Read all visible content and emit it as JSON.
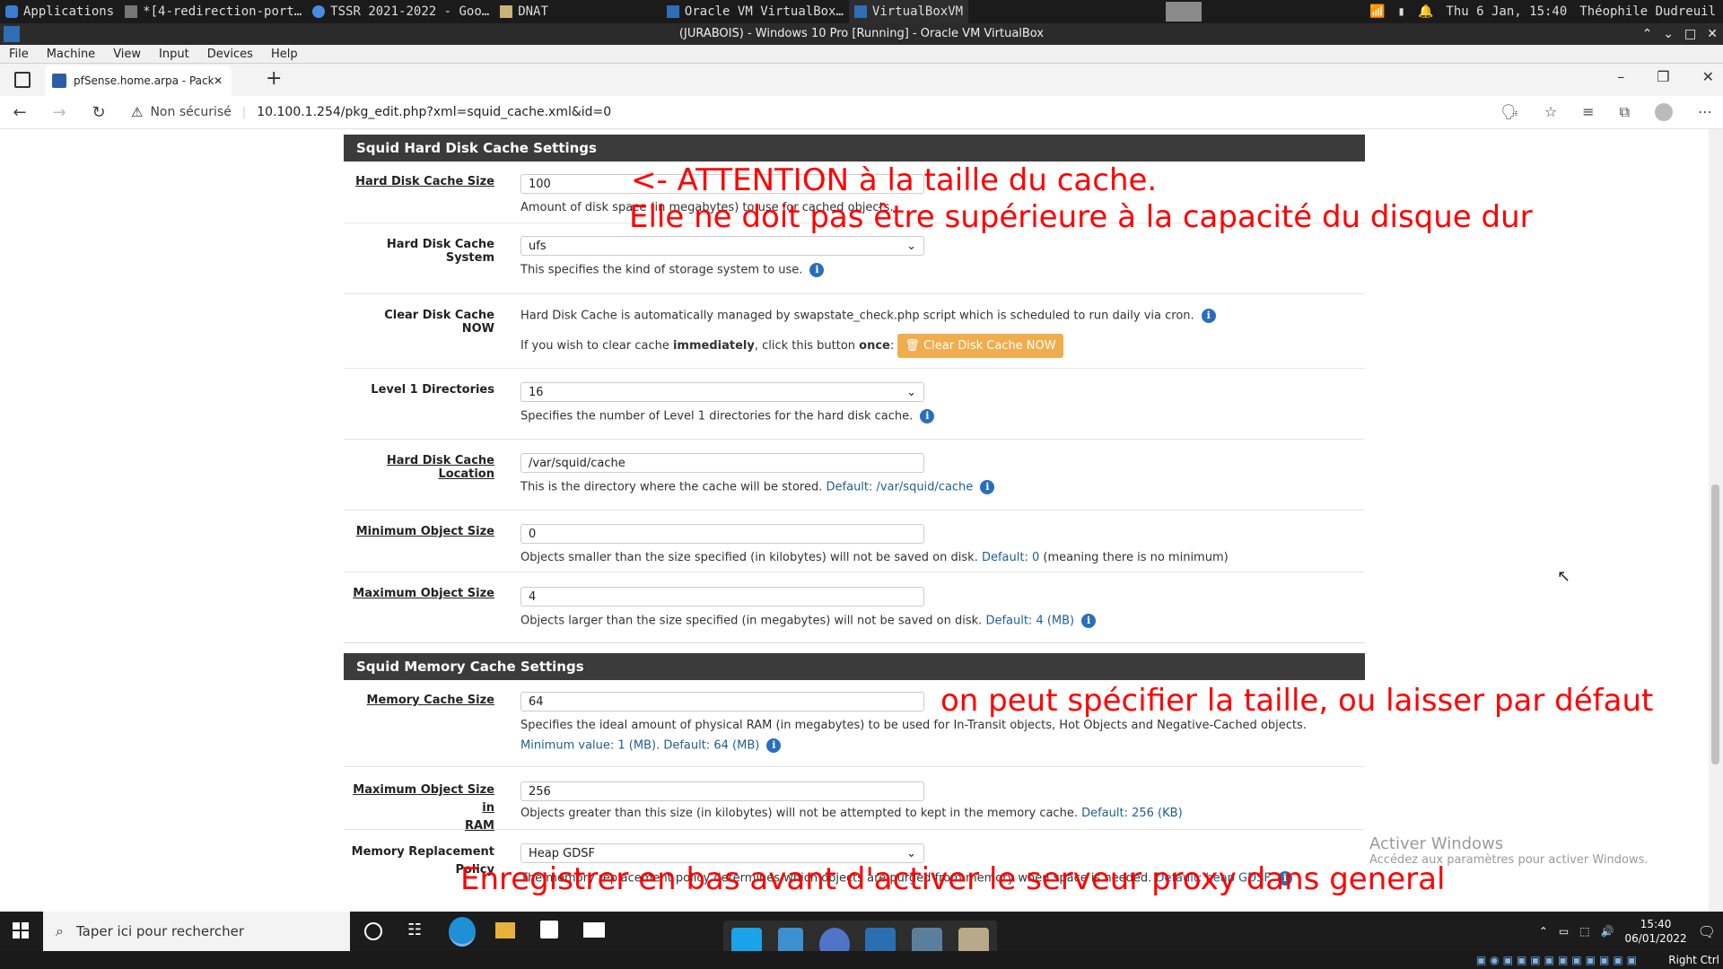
{
  "host_panel": {
    "applications": "Applications",
    "tasks": [
      "*[4-redirection-port…",
      "TSSR 2021-2022 - Goo…",
      "DNAT",
      "Oracle VM VirtualBox…",
      "VirtualBoxVM"
    ],
    "clock": "Thu  6 Jan, 15:40",
    "user": "Théophile Dudreuil"
  },
  "vbox": {
    "title": "(JURABOIS) - Windows 10 Pro [Running] - Oracle VM VirtualBox",
    "menu": [
      "File",
      "Machine",
      "View",
      "Input",
      "Devices",
      "Help"
    ]
  },
  "browser": {
    "tab_title": "pfSense.home.arpa - Package: Pr",
    "security": "Non sécurisé",
    "url": "10.100.1.254/pkg_edit.php?xml=squid_cache.xml&id=0"
  },
  "disk_section": {
    "title": "Squid Hard Disk Cache Settings",
    "rows": {
      "size": {
        "label": "Hard Disk Cache Size",
        "value": "100",
        "help": "Amount of disk space (in megabytes) to use for cached objects."
      },
      "system": {
        "label": "Hard Disk Cache System",
        "value": "ufs",
        "help": "This specifies the kind of storage system to use."
      },
      "clear": {
        "label": "Clear Disk Cache NOW",
        "help1": "Hard Disk Cache is automatically managed by swapstate_check.php script which is scheduled to run daily via cron.",
        "help2a": "If you wish to clear cache ",
        "help2b": "immediately",
        "help2c": ", click this button ",
        "help2d": "once",
        "help2e": ":",
        "button": "Clear Disk Cache NOW"
      },
      "l1": {
        "label": "Level 1 Directories",
        "value": "16",
        "help": "Specifies the number of Level 1 directories for the hard disk cache."
      },
      "location": {
        "label": "Hard Disk Cache Location",
        "value": "/var/squid/cache",
        "help": "This is the directory where the cache will be stored.",
        "default": "Default: /var/squid/cache"
      },
      "min": {
        "label": "Minimum Object Size",
        "value": "0",
        "help": "Objects smaller than the size specified (in kilobytes) will not be saved on disk.",
        "default": "Default: 0",
        "tail": "(meaning there is no minimum)"
      },
      "max": {
        "label": "Maximum Object Size",
        "value": "4",
        "help": "Objects larger than the size specified (in megabytes) will not be saved on disk.",
        "default": "Default: 4 (MB)"
      }
    }
  },
  "memory_section": {
    "title": "Squid Memory Cache Settings",
    "rows": {
      "size": {
        "label": "Memory Cache Size",
        "value": "64",
        "help": "Specifies the ideal amount of physical RAM (in megabytes) to be used for In-Transit objects, Hot Objects and Negative-Cached objects.",
        "default": "Minimum value: 1 (MB). Default: 64 (MB)"
      },
      "max_ram": {
        "label1": "Maximum Object Size in",
        "label2": "RAM",
        "value": "256",
        "help": "Objects greater than this size (in kilobytes) will not be attempted to kept in the memory cache.",
        "default": "Default: 256 (KB)"
      },
      "policy": {
        "label1": "Memory Replacement",
        "label2": "Policy",
        "value": "Heap GDSF",
        "help": "The memory replacement policy determines which objects are purged from memory when space is needed.",
        "default": "Default: heap GDSF"
      }
    }
  },
  "annotations": {
    "a1": "<- ATTENTION à la taille du cache.",
    "a2": "Elle ne doit pas être supérieure à la capacité du disque dur",
    "a3": "on peut spécifier la taille, ou laisser par défaut",
    "a4": "Enregistrer en bas avant d'activer le serveur proxy dans general"
  },
  "watermark": {
    "line1": "Activer Windows",
    "line2": "Accédez aux paramètres pour activer Windows."
  },
  "taskbar": {
    "search": "Taper ici pour rechercher",
    "time": "15:40",
    "date": "06/01/2022",
    "host_key": "Right Ctrl"
  },
  "colors": {
    "annotation": "#ff0000",
    "panel_header": "#3b3b3b",
    "warning_button": "#f0ad4e",
    "info_icon": "#2a6ebb"
  }
}
